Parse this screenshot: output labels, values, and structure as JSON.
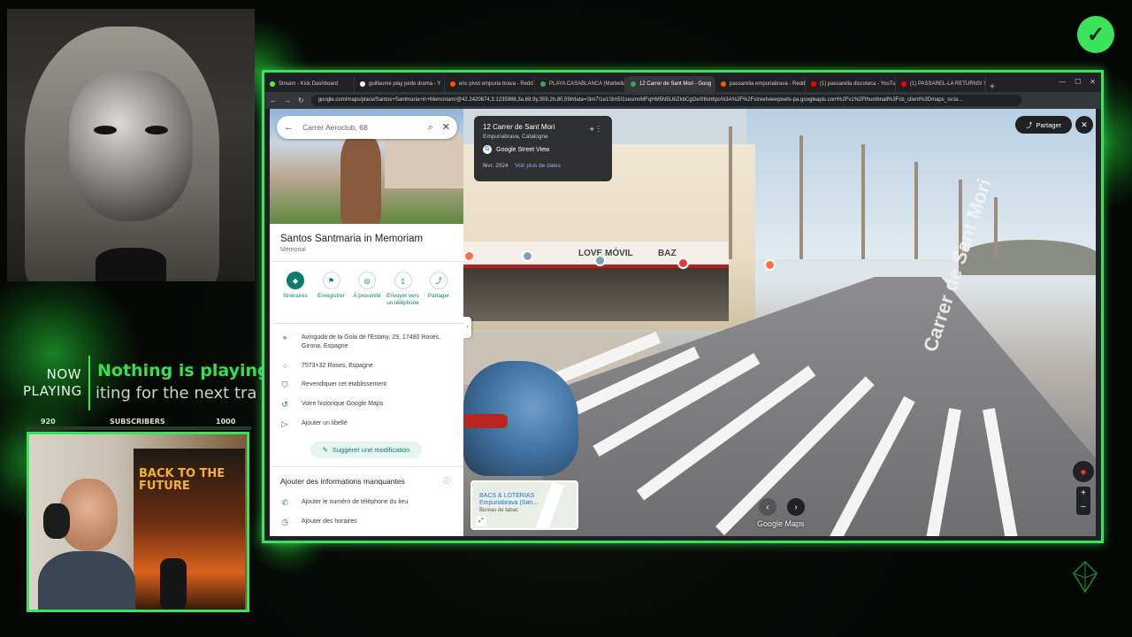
{
  "overlay": {
    "now_playing_label": "NOW PLAYING",
    "now_playing_title": "Nothing is playing",
    "now_playing_subtitle": "iting for the next tra",
    "subscribers_start": "920",
    "subscribers_label": "SUBSCRIBERS",
    "subscribers_goal": "1000",
    "subscribers_progress_fraction": 0.0,
    "accent_color": "#3be35a",
    "badge_icon": "check-icon"
  },
  "webcam_bottom": {
    "poster_title": "BACK TO THE FUTURE"
  },
  "browser": {
    "tabs": [
      {
        "label": "Stream - Kick Dashboard",
        "color": "#53fc18"
      },
      {
        "label": "guillaume play pedo drama - Y",
        "color": "#fff"
      },
      {
        "label": "enc pivot empuria brava - Redd",
        "color": "#ff5700"
      },
      {
        "label": "PLAYA CASABLANCA (Marbella)",
        "color": "#34a853"
      },
      {
        "label": "12 Carrer de Sant Mori - Goog",
        "color": "#34a853",
        "active": true
      },
      {
        "label": "passarella empuriabrava - Redd",
        "color": "#ff5700"
      },
      {
        "label": "(1) passarella discoteca - YouTu",
        "color": "#ff0000"
      },
      {
        "label": "(1) PASSAREL-LA RETURNS! SU",
        "color": "#ff0000"
      }
    ],
    "new_tab": "+",
    "url": "google.com/maps/place/Santos+Santmaria+in+Memoriam/@42.2420674,3.1235988,3a,68.9y,359.2h,80.59t/data=!3m7!1e1!3m5!1sesmnMFqHM5N5L6IZkbCgl2e0!6shttps%3A%2F%2Fstreetviewpixels-pa.googleapis.com%2Fv1%2Fthumbnail%3Fcb_client%3Dmaps_sv.ta..."
  },
  "maps": {
    "search": {
      "value": "Carrer Aeroclub, 68"
    },
    "place": {
      "title": "Santos Santmaria in Memoriam",
      "category": "Mémorial"
    },
    "actions": [
      {
        "label": "Itinéraires",
        "icon": "directions-icon",
        "primary": true
      },
      {
        "label": "Enregistrer",
        "icon": "bookmark-icon"
      },
      {
        "label": "À proximité",
        "icon": "nearby-icon"
      },
      {
        "label": "Envoyer vers un téléphone",
        "icon": "phone-icon"
      },
      {
        "label": "Partager",
        "icon": "share-icon"
      }
    ],
    "info": [
      {
        "icon": "location-pin-icon",
        "text": "Avinguda de la Gola de l'Estany, 29, 17480 Roses, Girona, Espagne"
      },
      {
        "icon": "plus-code-icon",
        "text": "7573+32 Roses, Espagne"
      },
      {
        "icon": "verified-shield-icon",
        "text": "Revendiquer cet établissement"
      },
      {
        "icon": "history-icon",
        "text": "Votre historique Google Maps"
      },
      {
        "icon": "label-icon",
        "text": "Ajouter un libellé"
      }
    ],
    "suggest": "Suggérer une modification",
    "missing_title": "Ajouter des informations manquantes",
    "missing": [
      {
        "icon": "phone-handset-icon",
        "text": "Ajouter le numéro de téléphone du lieu"
      },
      {
        "icon": "clock-icon",
        "text": "Ajouter des horaires"
      }
    ],
    "streetview": {
      "address": "12 Carrer de Sant Mori",
      "locality": "Empuriabrava, Catalogne",
      "provider": "Google Street View",
      "date": "févr. 2024",
      "more_dates": "Voir plus de dates",
      "share": "Partager",
      "shop_sign": "LOVE MÓVIL",
      "shop_sign2": "BAZ",
      "road_text": "Carrer de Sant Mori",
      "minimap_text": "BACS & LOTERIAS\nEmpuriabrava (San...",
      "minimap_text2": "Bureau de tabac",
      "brand": "Google Maps",
      "zoom_in": "+",
      "zoom_out": "−"
    }
  }
}
